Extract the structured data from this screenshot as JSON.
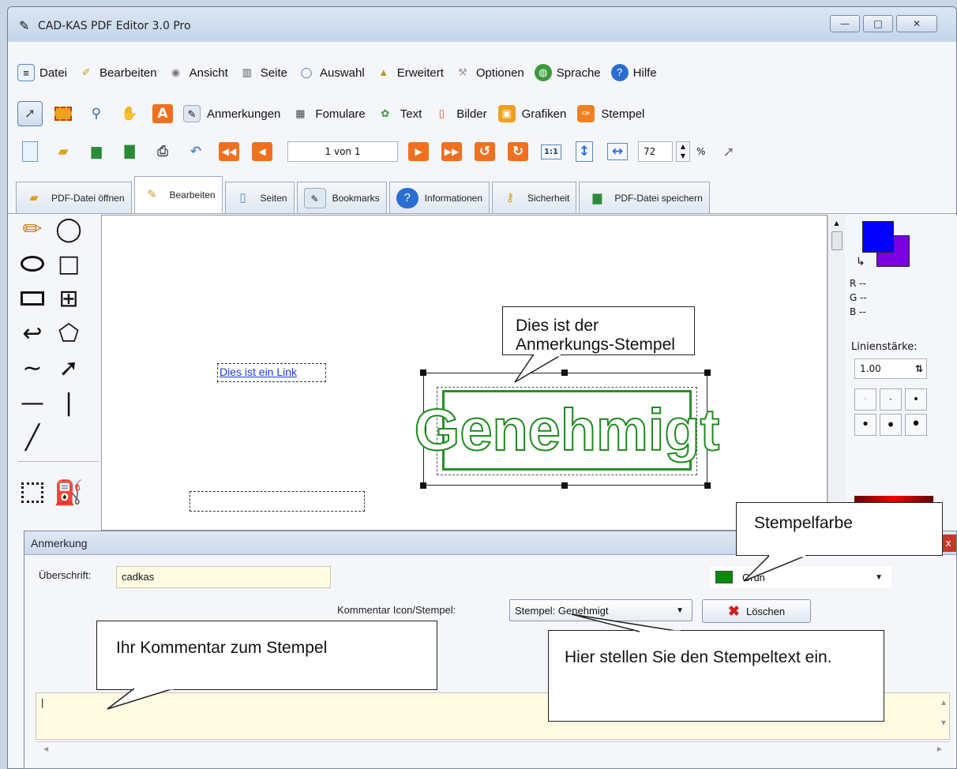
{
  "window": {
    "title": "CAD-KAS PDF Editor 3.0 Pro",
    "minimize": "—",
    "maximize": "□",
    "close": "✕"
  },
  "menu": [
    {
      "label": "Datei",
      "icon": "document-icon",
      "color": "#5a8ac0"
    },
    {
      "label": "Bearbeiten",
      "icon": "brush-icon",
      "color": "#c8a030"
    },
    {
      "label": "Ansicht",
      "icon": "magnifier-icon",
      "color": "#808080"
    },
    {
      "label": "Seite",
      "icon": "book-icon",
      "color": "#667"
    },
    {
      "label": "Auswahl",
      "icon": "speech-bubble-icon",
      "color": "#3b6ea5"
    },
    {
      "label": "Erweitert",
      "icon": "graduation-cap-icon",
      "color": "#c89020"
    },
    {
      "label": "Optionen",
      "icon": "wrench-icon",
      "color": "#aaa"
    },
    {
      "label": "Sprache",
      "icon": "globe-icon",
      "color": "#3a9a3a"
    },
    {
      "label": "Hilfe",
      "icon": "help-icon",
      "color": "#2a6fd0"
    }
  ],
  "toolbar1": {
    "labels": [
      "Anmerkungen",
      "Fomulare",
      "Text",
      "Bilder",
      "Grafiken",
      "Stempel"
    ]
  },
  "toolbar2": {
    "page": "1 von 1",
    "zoom": "72",
    "zoom_unit": "%",
    "ratio": "1:1"
  },
  "tabs": [
    "PDF-Datei öffnen",
    "Bearbeiten",
    "Seiten",
    "Bookmarks",
    "Informationen",
    "Sicherheit",
    "PDF-Datei speichern"
  ],
  "canvas": {
    "link_text": "Dies ist ein Link",
    "stamp_text": "Genehmigt"
  },
  "rightpanel": {
    "r": "R --",
    "g": "G --",
    "b": "B --",
    "linewidth_label": "Linienstärke:",
    "linewidth_value": "1.00",
    "primary": "#0000ff",
    "secondary": "#7a00e0"
  },
  "callouts": {
    "stamp": "Dies ist der Anmerkungs-Stempel",
    "color": "Stempelfarbe",
    "comment": "Ihr Kommentar zum Stempel",
    "stamptext": "Hier stellen Sie den Stempeltext ein."
  },
  "dialog": {
    "title": "Anmerkung",
    "heading_label": "Überschrift:",
    "heading_value": "cadkas",
    "color_name": "Grün",
    "color_hex": "#0a8a0a",
    "icon_label": "Kommentar Icon/Stempel:",
    "stamp_select": "Stempel: Genehmigt",
    "delete_label": "Löschen",
    "comment_value": "|"
  }
}
